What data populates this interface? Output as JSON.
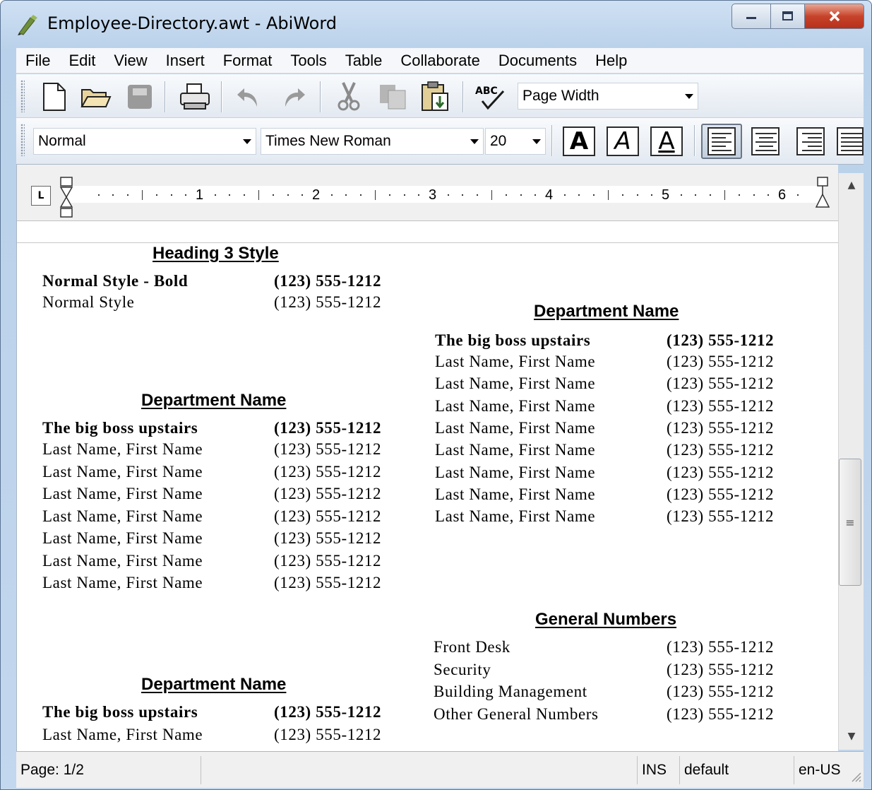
{
  "window": {
    "title": "Employee-Directory.awt - AbiWord",
    "minimize_glyph": "—",
    "maximize_glyph": "▢",
    "close_glyph": "✕"
  },
  "menu": [
    "File",
    "Edit",
    "View",
    "Insert",
    "Format",
    "Tools",
    "Table",
    "Collaborate",
    "Documents",
    "Help"
  ],
  "toolbar": {
    "zoom_value": "Page Width",
    "spellcheck_glyph": "ABC",
    "style_value": "Normal",
    "font_value": "Times New Roman",
    "size_value": "20",
    "bold_glyph": "A",
    "italic_glyph": "A",
    "underline_glyph": "A"
  },
  "ruler": {
    "numbers": [
      "1",
      "2",
      "3",
      "4",
      "5",
      "6"
    ],
    "tab_glyph": "L"
  },
  "document": {
    "left": {
      "heading3": "Heading 3 Style",
      "normal_bold_label": "Normal Style - Bold",
      "normal_bold_phone": "(123) 555-1212",
      "normal_label": "Normal Style",
      "normal_phone": "(123) 555-1212",
      "dept1": {
        "heading": "Department Name",
        "boss": "The big boss upstairs",
        "boss_phone": "(123) 555-1212",
        "rows": [
          {
            "name": "Last Name, First Name",
            "phone": "(123) 555-1212"
          },
          {
            "name": "Last Name, First Name",
            "phone": "(123) 555-1212"
          },
          {
            "name": "Last Name, First Name",
            "phone": "(123) 555-1212"
          },
          {
            "name": "Last Name, First Name",
            "phone": "(123) 555-1212"
          },
          {
            "name": "Last Name, First Name",
            "phone": "(123) 555-1212"
          },
          {
            "name": "Last Name, First Name",
            "phone": "(123) 555-1212"
          },
          {
            "name": "Last Name, First Name",
            "phone": "(123) 555-1212"
          }
        ]
      },
      "dept2": {
        "heading": "Department Name",
        "boss": "The big boss upstairs",
        "boss_phone": "(123) 555-1212",
        "rows": [
          {
            "name": "Last Name, First Name",
            "phone": "(123) 555-1212"
          }
        ]
      }
    },
    "right": {
      "dept": {
        "heading": "Department Name",
        "boss": "The big boss upstairs",
        "boss_phone": "(123) 555-1212",
        "rows": [
          {
            "name": "Last Name, First Name",
            "phone": "(123) 555-1212"
          },
          {
            "name": "Last Name, First Name",
            "phone": "(123) 555-1212"
          },
          {
            "name": "Last Name, First Name",
            "phone": "(123) 555-1212"
          },
          {
            "name": "Last Name, First Name",
            "phone": "(123) 555-1212"
          },
          {
            "name": "Last Name, First Name",
            "phone": "(123) 555-1212"
          },
          {
            "name": "Last Name, First Name",
            "phone": "(123) 555-1212"
          },
          {
            "name": "Last Name, First Name",
            "phone": "(123) 555-1212"
          },
          {
            "name": "Last Name, First Name",
            "phone": "(123) 555-1212"
          }
        ]
      },
      "general": {
        "heading": "General Numbers",
        "rows": [
          {
            "name": "Front Desk",
            "phone": "(123) 555-1212"
          },
          {
            "name": "Security",
            "phone": "(123) 555-1212"
          },
          {
            "name": "Building Management",
            "phone": "(123) 555-1212"
          },
          {
            "name": "Other General Numbers",
            "phone": "(123) 555-1212"
          }
        ]
      }
    }
  },
  "scrollbar": {
    "up_glyph": "▲",
    "down_glyph": "▼",
    "thumb_glyph": "≡"
  },
  "status": {
    "page": "Page: 1/2",
    "mode": "INS",
    "style": "default",
    "lang": "en-US"
  },
  "colors": {
    "window_frame": "#b9d1ea",
    "close_button": "#c7432b"
  }
}
